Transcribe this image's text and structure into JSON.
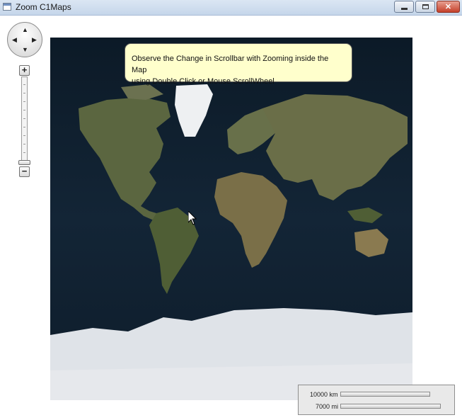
{
  "window": {
    "title": "Zoom C1Maps",
    "controls": {
      "close": "✕"
    }
  },
  "tooltip": {
    "line1": "Observe the Change in Scrollbar with Zooming inside the Map",
    "line2": "using Double Click or Mouse ScrollWheel"
  },
  "navigation": {
    "pan": {
      "up": "▲",
      "down": "▼",
      "left": "◀",
      "right": "▶"
    },
    "zoom_in": "+",
    "zoom_out": "−",
    "zoom_level": 0
  },
  "scale": {
    "metric_label": "10000 km",
    "imperial_label": "7000 mi"
  },
  "colors": {
    "ocean": "#0f1f2e",
    "land": "#5b6640",
    "ice": "#dfe3e8",
    "tooltip": "#ffffcc"
  }
}
